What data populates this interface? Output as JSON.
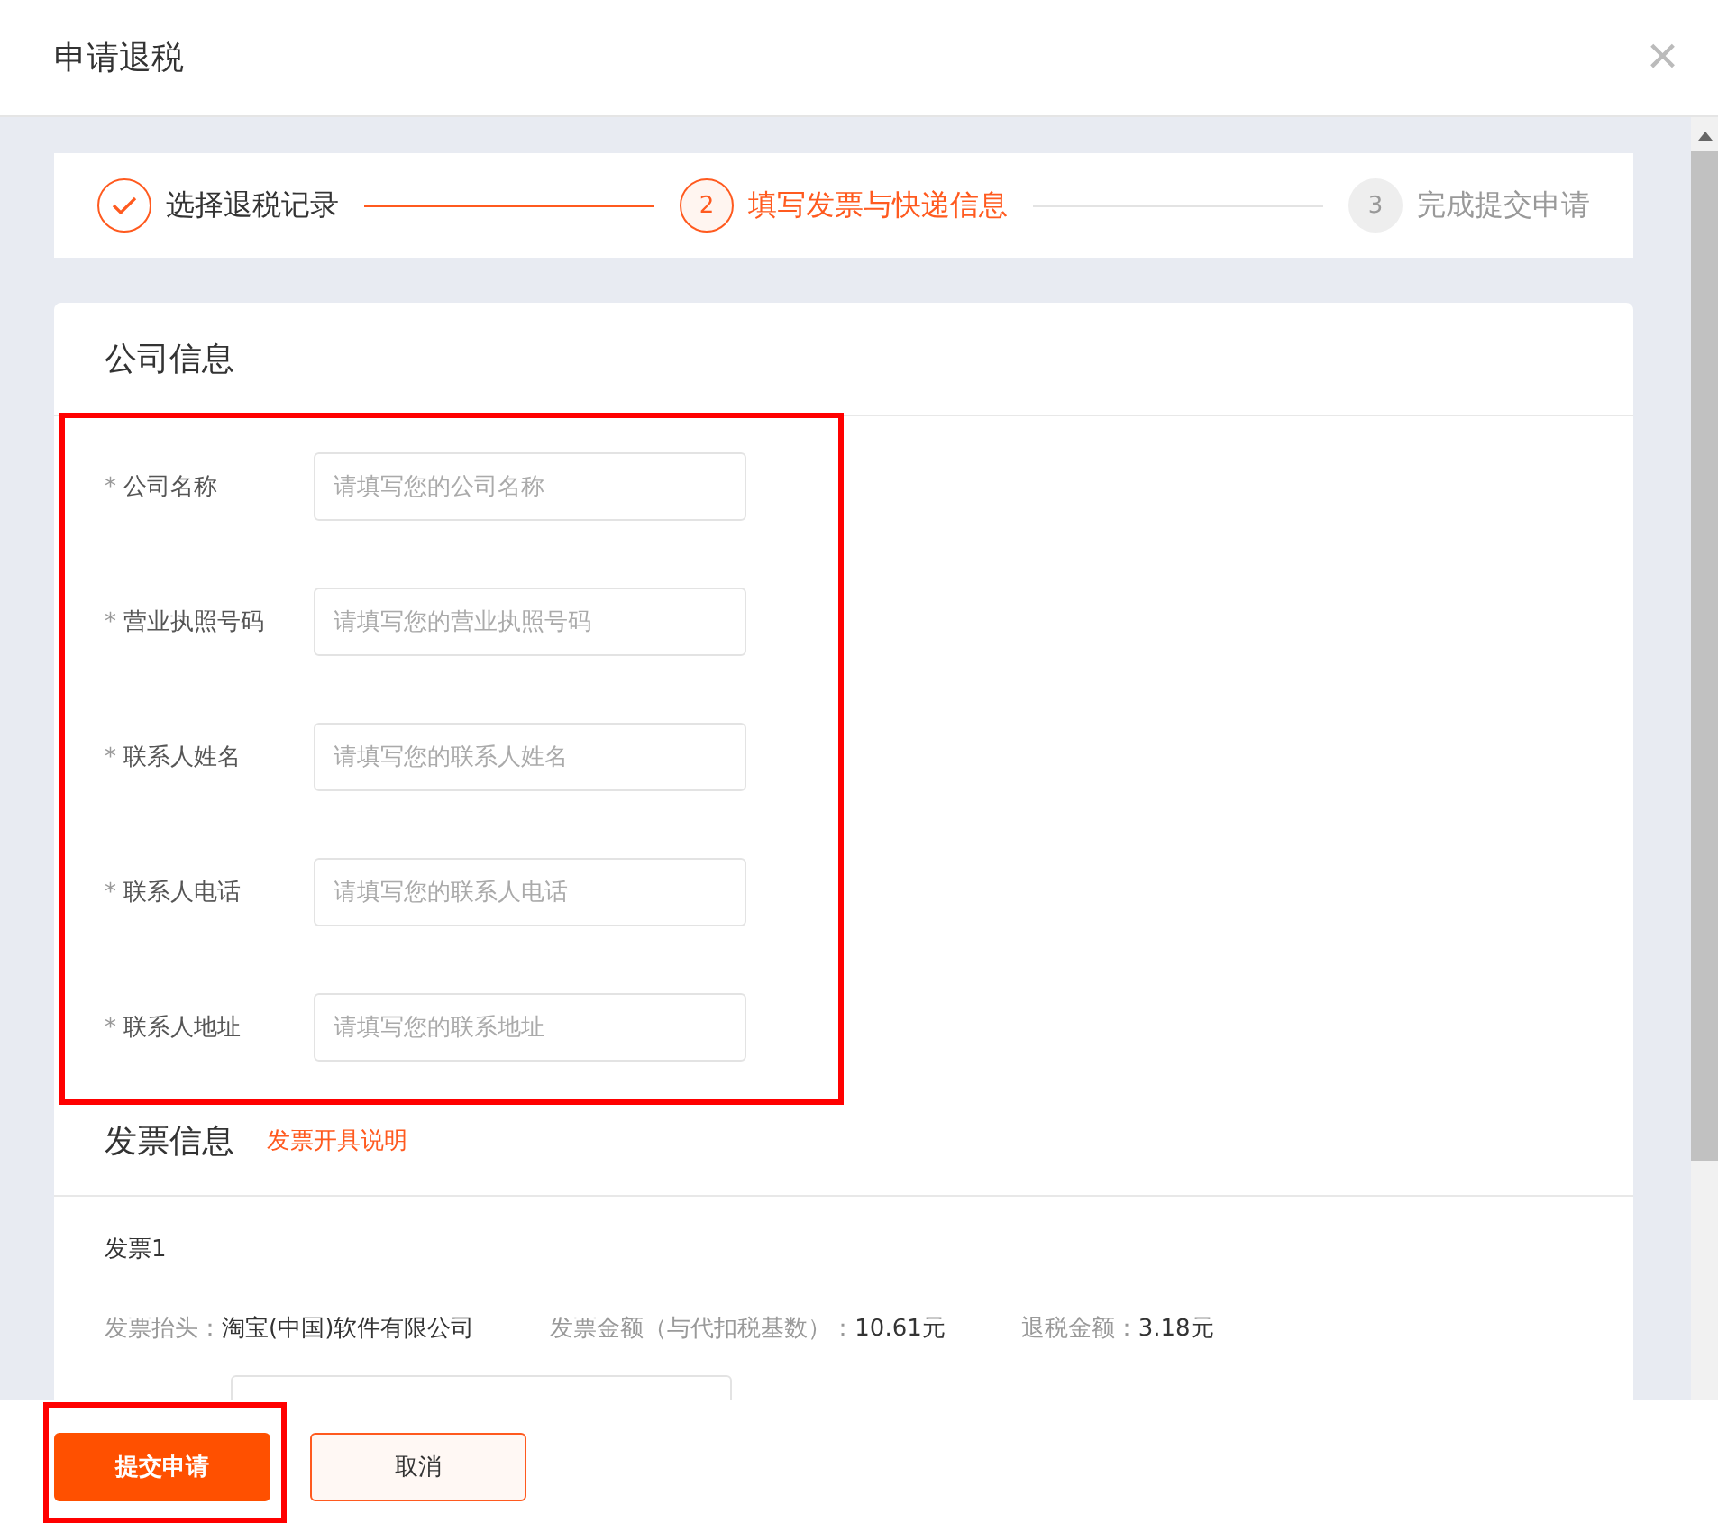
{
  "dialog": {
    "title": "申请退税",
    "close": "×"
  },
  "steps": [
    {
      "label": "选择退税记录",
      "completed": true,
      "selected": false
    },
    {
      "number": "2",
      "label": "填写发票与快递信息",
      "completed": false,
      "selected": true
    },
    {
      "number": "3",
      "label": "完成提交申请",
      "completed": false,
      "selected": false
    }
  ],
  "company": {
    "title": "公司信息",
    "fields": [
      {
        "marker": "*",
        "label": "公司名称",
        "placeholder": "请填写您的公司名称"
      },
      {
        "marker": "*",
        "label": "营业执照号码",
        "placeholder": "请填写您的营业执照号码"
      },
      {
        "marker": "*",
        "label": "联系人姓名",
        "placeholder": "请填写您的联系人姓名"
      },
      {
        "marker": "*",
        "label": "联系人电话",
        "placeholder": "请填写您的联系人电话"
      },
      {
        "marker": "*",
        "label": "联系人地址",
        "placeholder": "请填写您的联系地址"
      }
    ]
  },
  "invoice": {
    "title": "发票信息",
    "link": "发票开具说明",
    "name": "发票1",
    "items": [
      {
        "label": "发票抬头：",
        "value": "淘宝(中国)软件有限公司"
      },
      {
        "label": "发票金额（与代扣税基数）：",
        "value": "10.61元"
      },
      {
        "label": "退税金额：",
        "value": "3.18元"
      }
    ]
  },
  "buttons": [
    {
      "label": "提交申请",
      "kind": "primary"
    },
    {
      "label": "取消",
      "kind": "secondary"
    }
  ]
}
